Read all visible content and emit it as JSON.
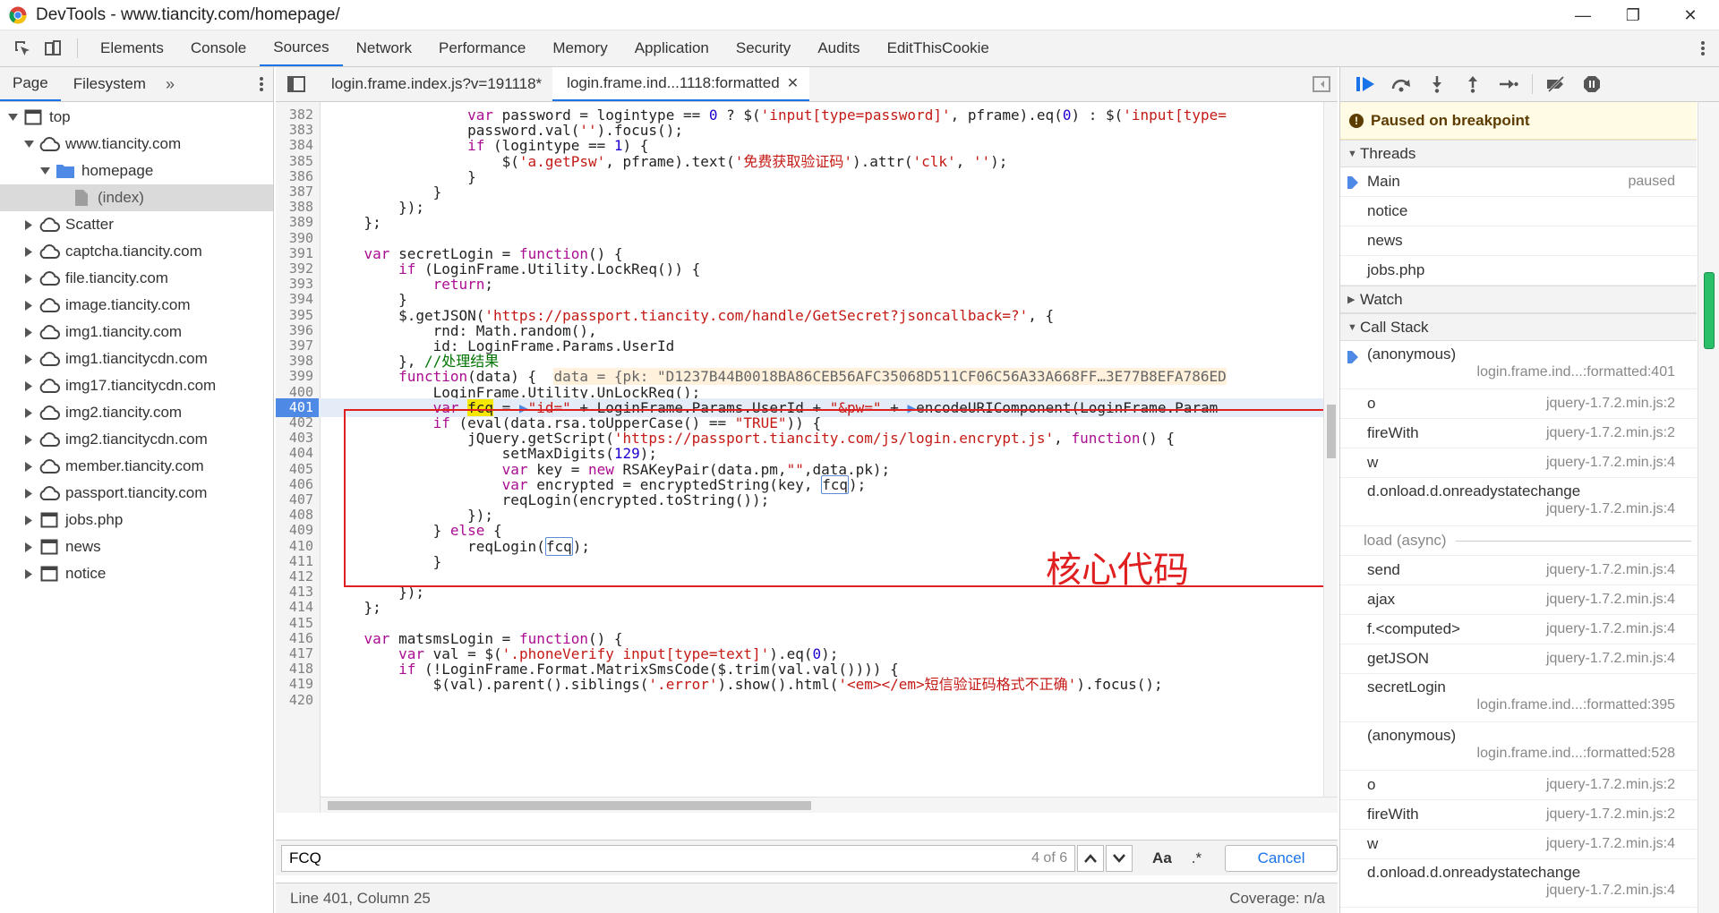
{
  "window": {
    "title": "DevTools - www.tiancity.com/homepage/",
    "minimize": "—",
    "maximize": "❐",
    "close": "✕"
  },
  "main_tabs": [
    "Elements",
    "Console",
    "Sources",
    "Network",
    "Performance",
    "Memory",
    "Application",
    "Security",
    "Audits",
    "EditThisCookie"
  ],
  "navigator": {
    "tabs": [
      "Page",
      "Filesystem"
    ],
    "tree": [
      {
        "label": "top",
        "icon": "frame-icon",
        "depth": 0,
        "arrow": "down"
      },
      {
        "label": "www.tiancity.com",
        "icon": "cloud-icon",
        "depth": 1,
        "arrow": "down"
      },
      {
        "label": "homepage",
        "icon": "folder-icon",
        "depth": 2,
        "arrow": "down"
      },
      {
        "label": "(index)",
        "icon": "file-icon",
        "depth": 3,
        "arrow": "none",
        "selected": true
      },
      {
        "label": "Scatter",
        "icon": "cloud-icon",
        "depth": 1,
        "arrow": "right"
      },
      {
        "label": "captcha.tiancity.com",
        "icon": "cloud-icon",
        "depth": 1,
        "arrow": "right"
      },
      {
        "label": "file.tiancity.com",
        "icon": "cloud-icon",
        "depth": 1,
        "arrow": "right"
      },
      {
        "label": "image.tiancity.com",
        "icon": "cloud-icon",
        "depth": 1,
        "arrow": "right"
      },
      {
        "label": "img1.tiancity.com",
        "icon": "cloud-icon",
        "depth": 1,
        "arrow": "right"
      },
      {
        "label": "img1.tiancitycdn.com",
        "icon": "cloud-icon",
        "depth": 1,
        "arrow": "right"
      },
      {
        "label": "img17.tiancitycdn.com",
        "icon": "cloud-icon",
        "depth": 1,
        "arrow": "right"
      },
      {
        "label": "img2.tiancity.com",
        "icon": "cloud-icon",
        "depth": 1,
        "arrow": "right"
      },
      {
        "label": "img2.tiancitycdn.com",
        "icon": "cloud-icon",
        "depth": 1,
        "arrow": "right"
      },
      {
        "label": "member.tiancity.com",
        "icon": "cloud-icon",
        "depth": 1,
        "arrow": "right"
      },
      {
        "label": "passport.tiancity.com",
        "icon": "cloud-icon",
        "depth": 1,
        "arrow": "right"
      },
      {
        "label": "jobs.php",
        "icon": "frame-icon",
        "depth": 1,
        "arrow": "right"
      },
      {
        "label": "news",
        "icon": "frame-icon",
        "depth": 1,
        "arrow": "right"
      },
      {
        "label": "notice",
        "icon": "frame-icon",
        "depth": 1,
        "arrow": "right"
      }
    ]
  },
  "editor": {
    "tabs": [
      {
        "label": "login.frame.index.js?v=191118*",
        "active": false
      },
      {
        "label": "login.frame.ind...1118:formatted",
        "active": true
      }
    ],
    "current_line": 401,
    "annotation": "核心代码",
    "lines": [
      {
        "n": 382,
        "html": "                <span class=\"kw\">var</span> password = logintype == <span class=\"num\">0</span> ? $(<span class=\"str\">'input[type=password]'</span>, pframe).eq(<span class=\"num\">0</span>) : $(<span class=\"str\">'input[type=</span>"
      },
      {
        "n": 383,
        "html": "                password.val(<span class=\"str\">''</span>).focus();"
      },
      {
        "n": 384,
        "html": "                <span class=\"kw\">if</span> (logintype == <span class=\"num\">1</span>) {"
      },
      {
        "n": 385,
        "html": "                    $(<span class=\"str\">'a.getPsw'</span>, pframe).text(<span class=\"str\">'免费获取验证码'</span>).attr(<span class=\"str\">'clk'</span>, <span class=\"str\">''</span>);"
      },
      {
        "n": 386,
        "html": "                }"
      },
      {
        "n": 387,
        "html": "            }"
      },
      {
        "n": 388,
        "html": "        });"
      },
      {
        "n": 389,
        "html": "    };"
      },
      {
        "n": 390,
        "html": ""
      },
      {
        "n": 391,
        "html": "    <span class=\"kw\">var</span> secretLogin = <span class=\"kw\">function</span>() {"
      },
      {
        "n": 392,
        "html": "        <span class=\"kw\">if</span> (LoginFrame.Utility.LockReq()) {"
      },
      {
        "n": 393,
        "html": "            <span class=\"kw\">return</span>;"
      },
      {
        "n": 394,
        "html": "        }"
      },
      {
        "n": 395,
        "html": "        $.getJSON(<span class=\"str\">'https://passport.tiancity.com/handle/GetSecret?jsoncallback=?'</span>, {"
      },
      {
        "n": 396,
        "html": "            rnd: Math.random(),"
      },
      {
        "n": 397,
        "html": "            id: LoginFrame.Params.UserId"
      },
      {
        "n": 398,
        "html": "        }, <span class=\"cmt\">//处理结果</span>"
      },
      {
        "n": 399,
        "html": "        <span class=\"kw\">function</span>(data) {  <span class=\"inline-val\">data = {pk: \"D1237B44B0018BA86CEB56AFC35068D511CF06C56A33A668FF…3E77B8EFA786ED</span>"
      },
      {
        "n": 400,
        "html": "            LoginFrame.Utility.UnLockReq();"
      },
      {
        "n": 401,
        "html": "            <span class=\"kw\">var</span> <span class=\"hl\">fcq</span> = <span style=\"color:#4e8ae5\">▶</span><span class=\"str\">\"id=\"</span> + LoginFrame.Params.UserId + <span class=\"str\">\"&amp;pw=\"</span> + <span style=\"color:#4e8ae5\">▶</span>encodeURIComponent(LoginFrame.Param"
      },
      {
        "n": 402,
        "html": "            <span class=\"kw\">if</span> (eval(data.rsa.toUpperCase() == <span class=\"str\">\"TRUE\"</span>)) {"
      },
      {
        "n": 403,
        "html": "                jQuery.getScript(<span class=\"str\">'https://passport.tiancity.com/js/login.encrypt.js'</span>, <span class=\"kw\">function</span>() {"
      },
      {
        "n": 404,
        "html": "                    setMaxDigits(<span class=\"num\">129</span>);"
      },
      {
        "n": 405,
        "html": "                    <span class=\"kw\">var</span> key = <span class=\"kw\">new</span> RSAKeyPair(data.pm,<span class=\"str\">\"\"</span>,data.pk);"
      },
      {
        "n": 406,
        "html": "                    <span class=\"kw\">var</span> encrypted = encryptedString(key, <span class=\"box\">fcq</span>);"
      },
      {
        "n": 407,
        "html": "                    reqLogin(encrypted.toString());"
      },
      {
        "n": 408,
        "html": "                });"
      },
      {
        "n": 409,
        "html": "            } <span class=\"kw\">else</span> {"
      },
      {
        "n": 410,
        "html": "                reqLogin(<span class=\"box\">fcq</span>);"
      },
      {
        "n": 411,
        "html": "            }"
      },
      {
        "n": 412,
        "html": ""
      },
      {
        "n": 413,
        "html": "        });"
      },
      {
        "n": 414,
        "html": "    };"
      },
      {
        "n": 415,
        "html": ""
      },
      {
        "n": 416,
        "html": "    <span class=\"kw\">var</span> matsmsLogin = <span class=\"kw\">function</span>() {"
      },
      {
        "n": 417,
        "html": "        <span class=\"kw\">var</span> val = $(<span class=\"str\">'.phoneVerify input[type=text]'</span>).eq(<span class=\"num\">0</span>);"
      },
      {
        "n": 418,
        "html": "        <span class=\"kw\">if</span> (!LoginFrame.Format.MatrixSmsCode($.trim(val.val()))) {"
      },
      {
        "n": 419,
        "html": "            $(val).parent().siblings(<span class=\"str\">'.error'</span>).show().html(<span class=\"str\">'&lt;em&gt;&lt;/em&gt;短信验证码格式不正确'</span>).focus();"
      },
      {
        "n": 420,
        "html": ""
      }
    ]
  },
  "search": {
    "value": "FCQ",
    "count": "4 of 6",
    "match_case": "Aa",
    "regex": ".*",
    "cancel": "Cancel"
  },
  "status": {
    "position": "Line 401, Column 25",
    "coverage": "Coverage: n/a"
  },
  "debugger": {
    "paused_message": "Paused on breakpoint",
    "threads_label": "Threads",
    "threads": [
      {
        "name": "Main",
        "state": "paused",
        "current": true
      },
      {
        "name": "notice",
        "state": ""
      },
      {
        "name": "news",
        "state": ""
      },
      {
        "name": "jobs.php",
        "state": ""
      }
    ],
    "watch_label": "Watch",
    "callstack_label": "Call Stack",
    "async_label": "load (async)",
    "frames_before": [
      {
        "fn": "(anonymous)",
        "loc": "login.frame.ind...:formatted:401",
        "layout": "double",
        "current": true
      },
      {
        "fn": "o",
        "loc": "jquery-1.7.2.min.js:2",
        "layout": "single"
      },
      {
        "fn": "fireWith",
        "loc": "jquery-1.7.2.min.js:2",
        "layout": "single"
      },
      {
        "fn": "w",
        "loc": "jquery-1.7.2.min.js:4",
        "layout": "single"
      },
      {
        "fn": "d.onload.d.onreadystatechange",
        "loc": "jquery-1.7.2.min.js:4",
        "layout": "double"
      }
    ],
    "frames_after": [
      {
        "fn": "send",
        "loc": "jquery-1.7.2.min.js:4",
        "layout": "single"
      },
      {
        "fn": "ajax",
        "loc": "jquery-1.7.2.min.js:4",
        "layout": "single"
      },
      {
        "fn": "f.<computed>",
        "loc": "jquery-1.7.2.min.js:4",
        "layout": "single"
      },
      {
        "fn": "getJSON",
        "loc": "jquery-1.7.2.min.js:4",
        "layout": "single"
      },
      {
        "fn": "secretLogin",
        "loc": "login.frame.ind...:formatted:395",
        "layout": "double"
      },
      {
        "fn": "(anonymous)",
        "loc": "login.frame.ind...:formatted:528",
        "layout": "double"
      },
      {
        "fn": "o",
        "loc": "jquery-1.7.2.min.js:2",
        "layout": "single"
      },
      {
        "fn": "fireWith",
        "loc": "jquery-1.7.2.min.js:2",
        "layout": "single"
      },
      {
        "fn": "w",
        "loc": "jquery-1.7.2.min.js:4",
        "layout": "single"
      },
      {
        "fn": "d.onload.d.onreadystatechange",
        "loc": "jquery-1.7.2.min.js:4",
        "layout": "double"
      }
    ]
  },
  "colors": {
    "accent": "#1a73e8",
    "breakpoint": "#4e8ae5",
    "annotation": "#e02020",
    "paused_bg": "#fffbe5"
  }
}
